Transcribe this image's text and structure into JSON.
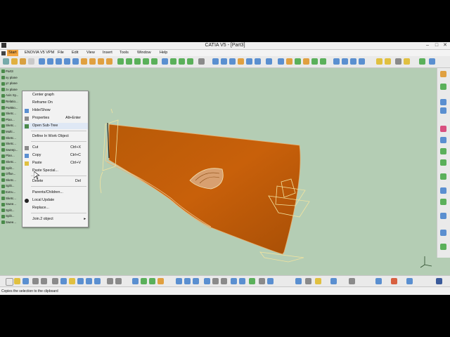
{
  "window": {
    "title": "CATIA V5 - [Part3]"
  },
  "menu": {
    "start": "Start",
    "enovia": "ENOVIA V5 VPM",
    "file": "File",
    "edit": "Edit",
    "view": "View",
    "insert": "Insert",
    "tools": "Tools",
    "window": "Window",
    "help": "Help"
  },
  "tree": {
    "items": [
      "Part3",
      "xy plane",
      "yz plane",
      "zx plane",
      "Axis Sy...",
      "Relatio...",
      "PartBo...",
      "Sketc...",
      "Plan...",
      "Sketc...",
      "Multi...",
      "Sketc...",
      "Sketc...",
      "Sweep...",
      "Plan...",
      "Sketc...",
      "Split...",
      "Offse...",
      "Sketc...",
      "Split...",
      "Extru...",
      "Sketc...",
      "Swee...",
      "Split...",
      "Split...",
      "Swee..."
    ]
  },
  "context_menu": {
    "center_graph": "Center graph",
    "reframe_on": "Reframe On",
    "hide_show": "Hide/Show",
    "properties": "Properties",
    "properties_shortcut": "Alt+Enter",
    "open_subtree": "Open Sub-Tree",
    "define_in_work_object": "Define In Work Object",
    "cut": "Cut",
    "cut_shortcut": "Ctrl+X",
    "copy": "Copy",
    "copy_shortcut": "Ctrl+C",
    "paste": "Paste",
    "paste_shortcut": "Ctrl+V",
    "paste_special": "Paste Special...",
    "delete": "Delete",
    "delete_shortcut": "Del",
    "parents_children": "Parents/Children...",
    "local_update": "Local Update",
    "replace": "Replace...",
    "join_object": "Join.2 object"
  },
  "status": {
    "message": "Copies the selection to the clipboard"
  },
  "colors": {
    "surface": "#c8600a",
    "background": "#b4cdb4",
    "accent": "#f4a640"
  }
}
